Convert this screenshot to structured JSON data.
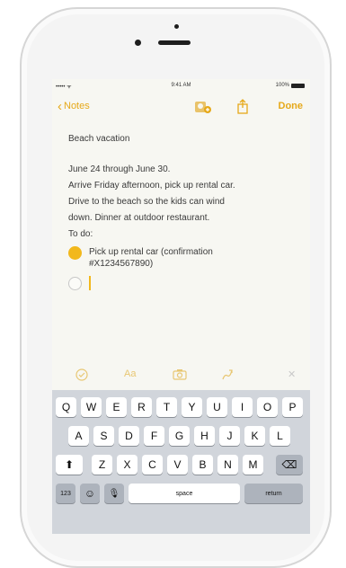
{
  "status": {
    "signal": "••••• ᯤ",
    "time": "9:41 AM",
    "battery": "100%"
  },
  "nav": {
    "back_label": "Notes",
    "done_label": "Done"
  },
  "note": {
    "title": "Beach vacation",
    "body": [
      "June 24 through June 30.",
      "Arrive Friday afternoon, pick up rental car.",
      "Drive to the beach so the kids can wind",
      "down. Dinner at outdoor restaurant."
    ],
    "todo_label": "To do:",
    "todos": [
      {
        "text_line1": "Pick up rental car (confirmation",
        "text_line2": "#X1234567890)",
        "checked": true
      }
    ]
  },
  "toolbar": {
    "format_label": "Aa",
    "close_label": "✕"
  },
  "keyboard": {
    "row1": [
      "Q",
      "W",
      "E",
      "R",
      "T",
      "Y",
      "U",
      "I",
      "O",
      "P"
    ],
    "row2": [
      "A",
      "S",
      "D",
      "F",
      "G",
      "H",
      "J",
      "K",
      "L"
    ],
    "row3": [
      "Z",
      "X",
      "C",
      "V",
      "B",
      "N",
      "M"
    ],
    "numbers_label": "123",
    "space_label": "space",
    "return_label": "return",
    "shift_glyph": "⬆",
    "delete_glyph": "⌫",
    "emoji_glyph": "☺",
    "mic_glyph": "🎙"
  },
  "colors": {
    "accent": "#e6a91a",
    "check": "#f2b81c",
    "keyboard_bg": "#d1d5db"
  }
}
